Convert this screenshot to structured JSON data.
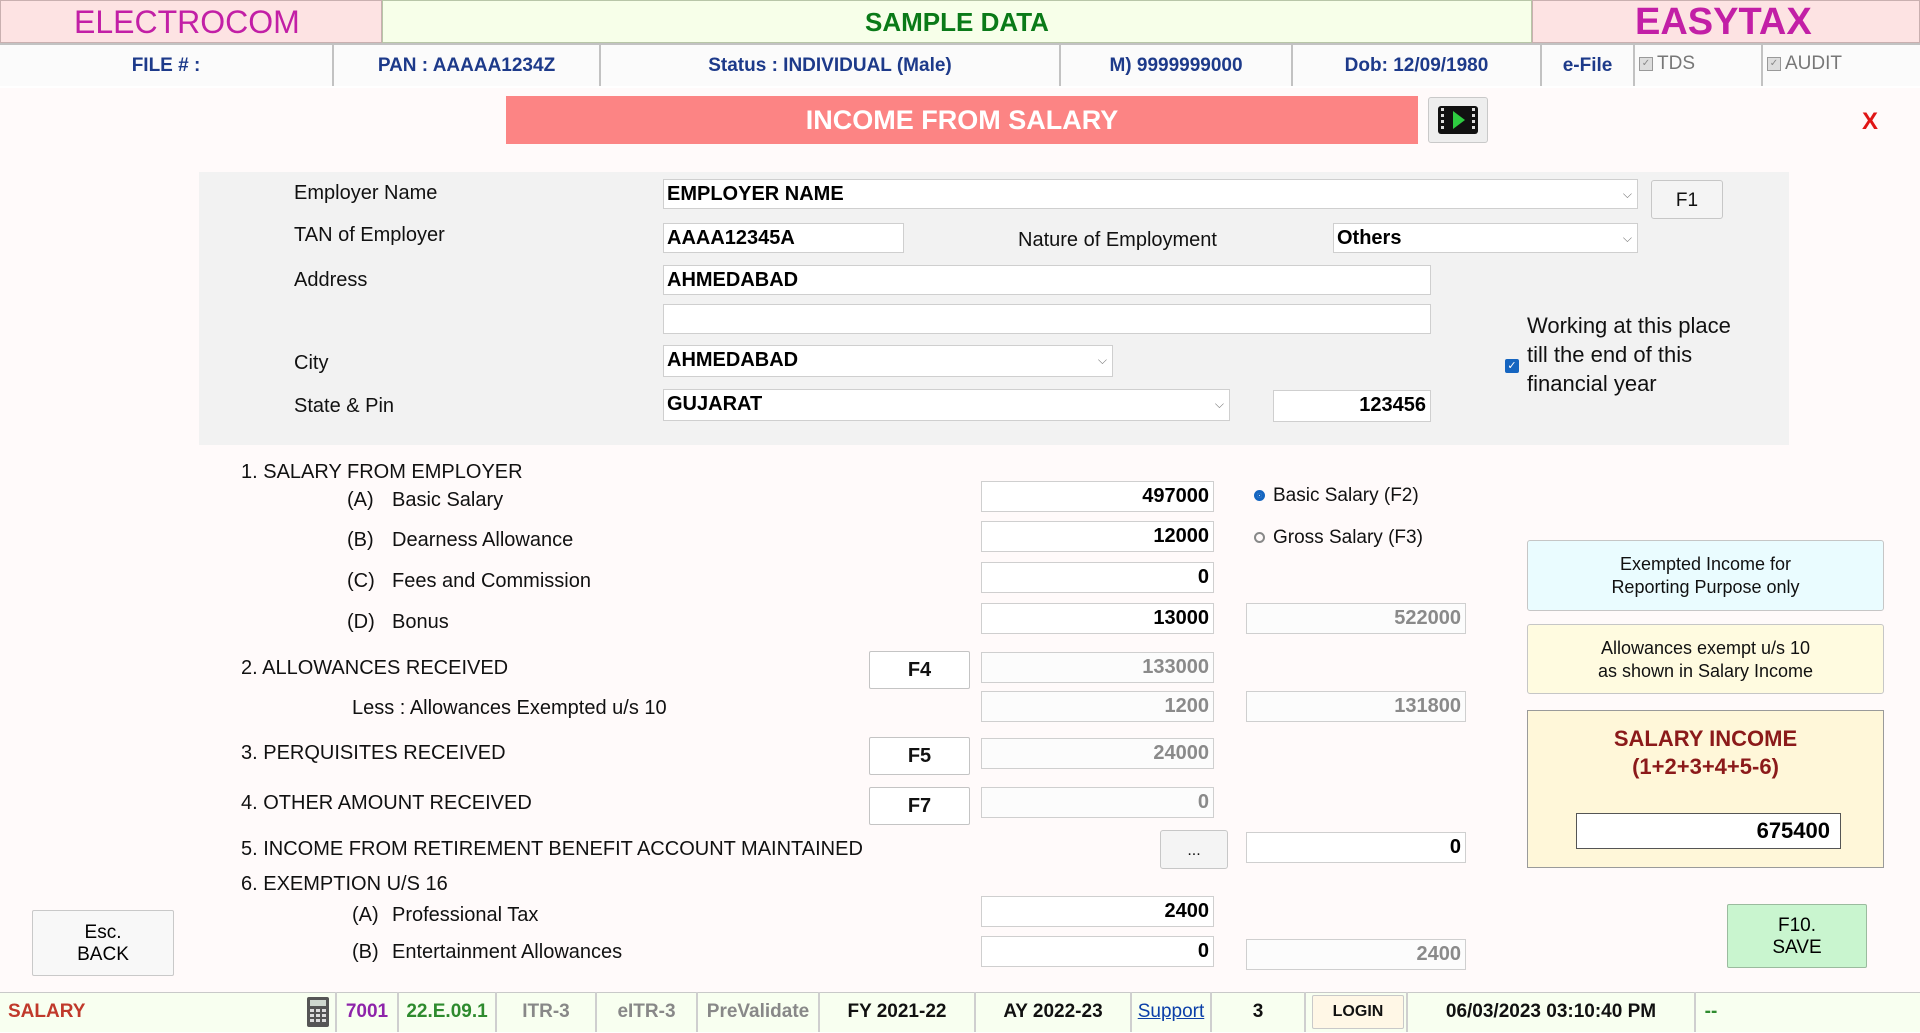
{
  "header": {
    "brand_left": "ELECTROCOM",
    "center_title": "SAMPLE DATA",
    "brand_right": "EASYTAX"
  },
  "info_bar": {
    "file_no": "FILE # :",
    "pan": "PAN : AAAAA1234Z",
    "status": "Status : INDIVIDUAL (Male)",
    "mobile": "M) 9999999000",
    "dob": "Dob: 12/09/1980",
    "efile": "e-File",
    "tds": "TDS",
    "audit": "AUDIT"
  },
  "page": {
    "title": "INCOME FROM SALARY",
    "close": "X"
  },
  "employer": {
    "name_label": "Employer Name",
    "name_value": "EMPLOYER NAME",
    "f1_button": "F1",
    "tan_label": "TAN of Employer",
    "tan_value": "AAAA12345A",
    "nature_label": "Nature of Employment",
    "nature_value": "Others",
    "address_label": "Address",
    "address_line1": "AHMEDABAD",
    "address_line2": "",
    "city_label": "City",
    "city_value": "AHMEDABAD",
    "state_label": "State & Pin",
    "state_value": "GUJARAT",
    "pin_value": "123456",
    "working_checked": true,
    "working_label_1": "Working at this place",
    "working_label_2": "till the end of this",
    "working_label_3": "financial year"
  },
  "salary": {
    "s1_label": "1. SALARY FROM EMPLOYER",
    "a_prefix": "(A)",
    "a_label": "Basic Salary",
    "a_value": "497000",
    "b_prefix": "(B)",
    "b_label": "Dearness Allowance",
    "b_value": "12000",
    "c_prefix": "(C)",
    "c_label": "Fees and Commission",
    "c_value": "0",
    "d_prefix": "(D)",
    "d_label": "Bonus",
    "d_value": "13000",
    "s1_total": "522000",
    "radio_basic": "Basic Salary (F2)",
    "radio_gross": "Gross Salary (F3)",
    "s2_label": "2. ALLOWANCES RECEIVED",
    "s2_button": "F4",
    "s2_value": "133000",
    "s2_less_label": "Less : Allowances Exempted u/s 10",
    "s2_less_value": "1200",
    "s2_total": "131800",
    "s3_label": "3. PERQUISITES RECEIVED",
    "s3_button": "F5",
    "s3_value": "24000",
    "s4_label": "4. OTHER AMOUNT RECEIVED",
    "s4_button": "F7",
    "s4_value": "0",
    "s5_label": "5. INCOME FROM RETIREMENT BENEFIT ACCOUNT MAINTAINED",
    "s5_button": "...",
    "s5_value": "0",
    "s6_label": "6. EXEMPTION U/S 16",
    "s6a_prefix": "(A)",
    "s6a_label": "Professional Tax",
    "s6a_value": "2400",
    "s6b_prefix": "(B)",
    "s6b_label": "Entertainment Allowances",
    "s6b_value": "0",
    "s6_total": "2400"
  },
  "side": {
    "exempt_line1": "Exempted Income for",
    "exempt_line2": "Reporting Purpose only",
    "allow_line1": "Allowances exempt u/s 10",
    "allow_line2": "as shown in Salary Income",
    "income_title1": "SALARY INCOME",
    "income_title2": "(1+2+3+4+5-6)",
    "income_value": "675400",
    "save_line1": "F10.",
    "save_line2": "SAVE"
  },
  "back_button": {
    "line1": "Esc.",
    "line2": "BACK"
  },
  "statusbar": {
    "module": "SALARY",
    "code": "7001",
    "version": "22.E.09.1",
    "itr": "ITR-3",
    "eitr": "eITR-3",
    "prevalidate": "PreValidate",
    "fy": "FY 2021-22",
    "ay": "AY 2022-23",
    "support": "Support",
    "count": "3",
    "login": "LOGIN",
    "datetime": "06/03/2023 03:10:40 PM",
    "extra": "--"
  },
  "colors": {
    "title_bar": "#fc8484",
    "brand": "#c21fa6",
    "sample_green": "#0a7a18",
    "info_blue": "#1d3a8a",
    "salary_income_red": "#8b1a1a",
    "save_green": "#c9f5cf"
  }
}
